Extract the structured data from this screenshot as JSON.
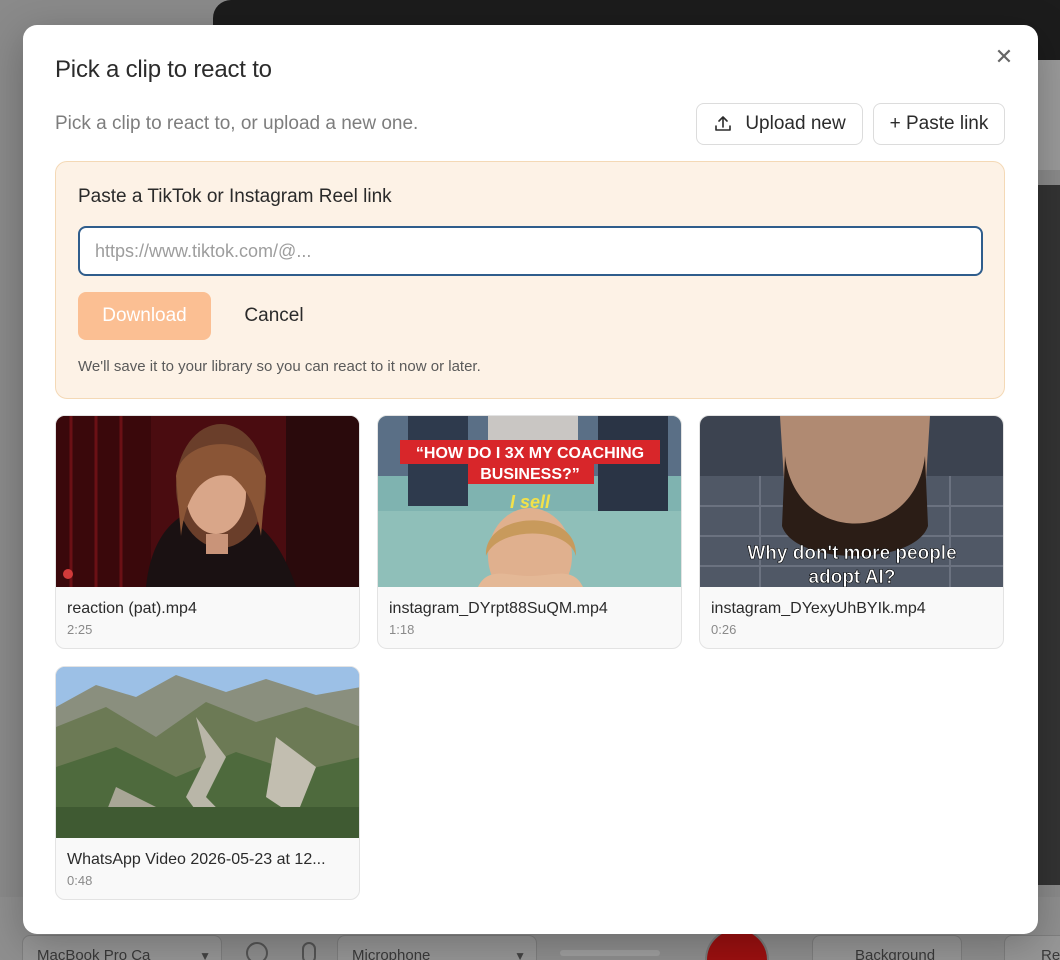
{
  "modal": {
    "title": "Pick a clip to react to",
    "subtitle": "Pick a clip to react to, or upload a new one.",
    "close_icon": "close-icon",
    "upload_label": "Upload new",
    "paste_link_label": "+ Paste link"
  },
  "paste_panel": {
    "label": "Paste a TikTok or Instagram Reel link",
    "input_placeholder": "https://www.tiktok.com/@...",
    "input_value": "",
    "download_label": "Download",
    "cancel_label": "Cancel",
    "help_text": "We'll save it to your library so you can react to it now or later."
  },
  "clips": [
    {
      "name": "reaction (pat).mp4",
      "duration": "2:25"
    },
    {
      "name": "instagram_DYrpt88SuQM.mp4",
      "duration": "1:18",
      "caption_line1": "“HOW DO I 3X MY COACHING",
      "caption_line2": "BUSINESS?”",
      "caption_sub": "I sell"
    },
    {
      "name": "instagram_DYexyUhBYIk.mp4",
      "duration": "0:26",
      "caption_line1": "Why don't more people",
      "caption_line2": "adopt AI?"
    },
    {
      "name": "WhatsApp Video 2026-05-23 at 12...",
      "duration": "0:48"
    }
  ],
  "background_app": {
    "camera_select": "MacBook Pro Ca",
    "microphone_select": "Microphone",
    "background_button": "Background",
    "right_button": "Re"
  },
  "colors": {
    "accent": "#fbbf93",
    "panel_bg": "#fdf2e6",
    "input_border": "#2f5d8c"
  }
}
